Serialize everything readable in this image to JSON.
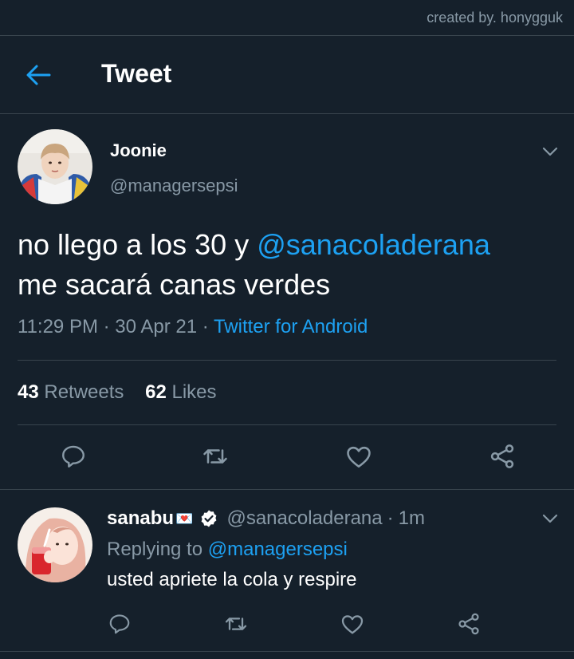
{
  "watermark": "created by. honygguk",
  "header": {
    "title": "Tweet",
    "back_icon": "arrow-left-icon"
  },
  "tweet": {
    "name": "Joonie",
    "handle": "@managersepsi",
    "text_before": "no llego a los 30 y ",
    "mention": "@sanacoladerana",
    "text_after": "me sacará canas verdes",
    "time": "11:29 PM",
    "date": "30 Apr 21",
    "separator": "·",
    "source": "Twitter for Android",
    "retweets_count": "43",
    "retweets_label": "Retweets",
    "likes_count": "62",
    "likes_label": "Likes"
  },
  "reply": {
    "name": "sanabu",
    "emoji": "💌",
    "handle": "@sanacoladerana",
    "time": "1m",
    "separator": "·",
    "replying_label": "Replying to",
    "replying_handle": "@managersepsi",
    "text": "usted apriete la cola y respire"
  },
  "colors": {
    "background": "#15202b",
    "accent": "#1da1f2",
    "secondary_text": "#8899a6",
    "divider": "#38444d"
  },
  "icons": [
    "reply-icon",
    "retweet-icon",
    "like-icon",
    "share-icon",
    "chevron-down-icon",
    "verified-icon"
  ]
}
